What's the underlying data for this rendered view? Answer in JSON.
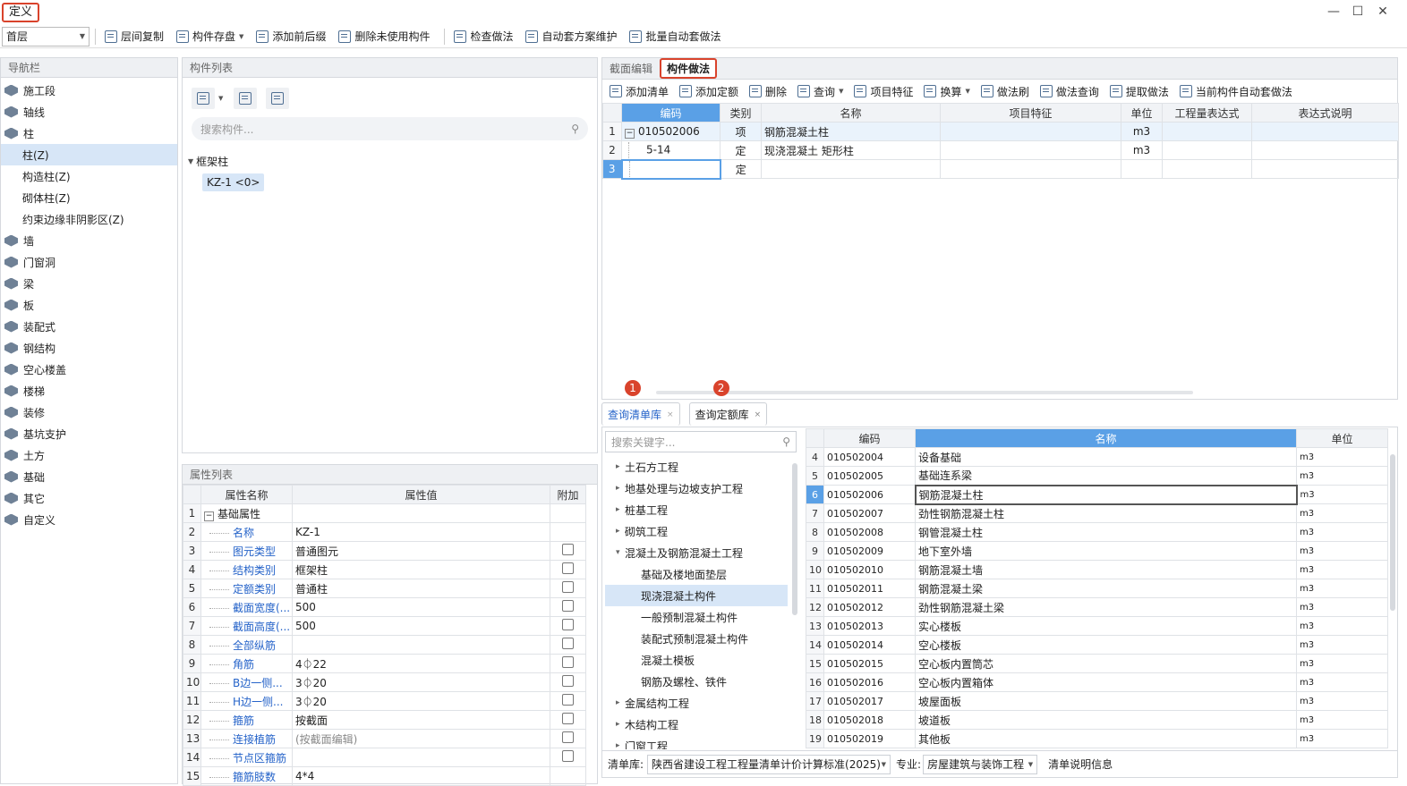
{
  "title": "定义",
  "toolbar": {
    "floor_select": "首层",
    "buttons": [
      "层间复制",
      "构件存盘",
      "添加前后缀",
      "删除未使用构件",
      "检查做法",
      "自动套方案维护",
      "批量自动套做法"
    ]
  },
  "nav": {
    "header": "导航栏",
    "items": [
      {
        "label": "施工段",
        "sub": false
      },
      {
        "label": "轴线",
        "sub": false
      },
      {
        "label": "柱",
        "sub": false
      },
      {
        "label": "柱(Z)",
        "sub": true,
        "active": true
      },
      {
        "label": "构造柱(Z)",
        "sub": true
      },
      {
        "label": "砌体柱(Z)",
        "sub": true
      },
      {
        "label": "约束边缘非阴影区(Z)",
        "sub": true
      },
      {
        "label": "墙",
        "sub": false
      },
      {
        "label": "门窗洞",
        "sub": false
      },
      {
        "label": "梁",
        "sub": false
      },
      {
        "label": "板",
        "sub": false
      },
      {
        "label": "装配式",
        "sub": false
      },
      {
        "label": "钢结构",
        "sub": false
      },
      {
        "label": "空心楼盖",
        "sub": false
      },
      {
        "label": "楼梯",
        "sub": false
      },
      {
        "label": "装修",
        "sub": false
      },
      {
        "label": "基坑支护",
        "sub": false
      },
      {
        "label": "土方",
        "sub": false
      },
      {
        "label": "基础",
        "sub": false
      },
      {
        "label": "其它",
        "sub": false
      },
      {
        "label": "自定义",
        "sub": false
      }
    ]
  },
  "component_list": {
    "header": "构件列表",
    "search_placeholder": "搜索构件...",
    "group": "框架柱",
    "item": "KZ-1 <0>"
  },
  "properties": {
    "header": "属性列表",
    "columns": [
      "属性名称",
      "属性值",
      "附加"
    ],
    "rows": [
      {
        "n": "1",
        "name": "基础属性",
        "value": "",
        "group": true
      },
      {
        "n": "2",
        "name": "名称",
        "value": "KZ-1",
        "chk": false
      },
      {
        "n": "3",
        "name": "图元类型",
        "value": "普通图元",
        "chk": true
      },
      {
        "n": "4",
        "name": "结构类别",
        "value": "框架柱",
        "chk": true
      },
      {
        "n": "5",
        "name": "定额类别",
        "value": "普通柱",
        "chk": true
      },
      {
        "n": "6",
        "name": "截面宽度(...",
        "value": "500",
        "chk": true
      },
      {
        "n": "7",
        "name": "截面高度(...",
        "value": "500",
        "chk": true
      },
      {
        "n": "8",
        "name": "全部纵筋",
        "value": "",
        "chk": true
      },
      {
        "n": "9",
        "name": "角筋",
        "value": "4⏀22",
        "chk": true
      },
      {
        "n": "10",
        "name": "B边一侧...",
        "value": "3⏀20",
        "chk": true
      },
      {
        "n": "11",
        "name": "H边一侧...",
        "value": "3⏀20",
        "chk": true
      },
      {
        "n": "12",
        "name": "箍筋",
        "value": "按截面",
        "chk": true
      },
      {
        "n": "13",
        "name": "连接植筋",
        "value": "(按截面编辑)",
        "chk": true
      },
      {
        "n": "14",
        "name": "节点区箍筋",
        "value": "",
        "chk": true
      },
      {
        "n": "15",
        "name": "箍筋肢数",
        "value": "4*4",
        "chk": false
      }
    ]
  },
  "method": {
    "tabs": [
      "截面编辑",
      "构件做法"
    ],
    "toolbar": [
      "添加清单",
      "添加定额",
      "删除",
      "查询",
      "项目特征",
      "换算",
      "做法刷",
      "做法查询",
      "提取做法",
      "当前构件自动套做法"
    ],
    "columns": [
      "编码",
      "类别",
      "名称",
      "项目特征",
      "单位",
      "工程量表达式",
      "表达式说明"
    ],
    "rows": [
      {
        "n": "1",
        "code": "010502006",
        "type": "项",
        "name": "钢筋混凝土柱",
        "feature": "",
        "unit": "m3"
      },
      {
        "n": "2",
        "code": "5-14",
        "type": "定",
        "name": "现浇混凝土 矩形柱",
        "feature": "",
        "unit": "m3"
      },
      {
        "n": "3",
        "code": "",
        "type": "定",
        "name": "",
        "feature": "",
        "unit": ""
      }
    ]
  },
  "query": {
    "tabs": [
      "查询清单库",
      "查询定额库"
    ],
    "badges": [
      "1",
      "2"
    ],
    "search_placeholder": "搜索关键字...",
    "tree": [
      {
        "label": "土石方工程",
        "level": 0,
        "arrow": "▸"
      },
      {
        "label": "地基处理与边坡支护工程",
        "level": 0,
        "arrow": "▸"
      },
      {
        "label": "桩基工程",
        "level": 0,
        "arrow": "▸"
      },
      {
        "label": "砌筑工程",
        "level": 0,
        "arrow": "▸"
      },
      {
        "label": "混凝土及钢筋混凝土工程",
        "level": 0,
        "arrow": "▾"
      },
      {
        "label": "基础及楼地面垫层",
        "level": 1,
        "arrow": ""
      },
      {
        "label": "现浇混凝土构件",
        "level": 1,
        "arrow": "",
        "active": true
      },
      {
        "label": "一般预制混凝土构件",
        "level": 1,
        "arrow": ""
      },
      {
        "label": "装配式预制混凝土构件",
        "level": 1,
        "arrow": ""
      },
      {
        "label": "混凝土模板",
        "level": 1,
        "arrow": ""
      },
      {
        "label": "钢筋及螺栓、铁件",
        "level": 1,
        "arrow": ""
      },
      {
        "label": "金属结构工程",
        "level": 0,
        "arrow": "▸"
      },
      {
        "label": "木结构工程",
        "level": 0,
        "arrow": "▸"
      },
      {
        "label": "门窗工程",
        "level": 0,
        "arrow": "▸"
      }
    ],
    "columns": [
      "编码",
      "名称",
      "单位"
    ],
    "rows": [
      {
        "n": "4",
        "code": "010502004",
        "name": "设备基础",
        "unit": "m3"
      },
      {
        "n": "5",
        "code": "010502005",
        "name": "基础连系梁",
        "unit": "m3"
      },
      {
        "n": "6",
        "code": "010502006",
        "name": "钢筋混凝土柱",
        "unit": "m3",
        "active": true
      },
      {
        "n": "7",
        "code": "010502007",
        "name": "劲性钢筋混凝土柱",
        "unit": "m3"
      },
      {
        "n": "8",
        "code": "010502008",
        "name": "钢管混凝土柱",
        "unit": "m3"
      },
      {
        "n": "9",
        "code": "010502009",
        "name": "地下室外墙",
        "unit": "m3"
      },
      {
        "n": "10",
        "code": "010502010",
        "name": "钢筋混凝土墙",
        "unit": "m3"
      },
      {
        "n": "11",
        "code": "010502011",
        "name": "钢筋混凝土梁",
        "unit": "m3"
      },
      {
        "n": "12",
        "code": "010502012",
        "name": "劲性钢筋混凝土梁",
        "unit": "m3"
      },
      {
        "n": "13",
        "code": "010502013",
        "name": "实心楼板",
        "unit": "m3"
      },
      {
        "n": "14",
        "code": "010502014",
        "name": "空心楼板",
        "unit": "m3"
      },
      {
        "n": "15",
        "code": "010502015",
        "name": "空心板内置筒芯",
        "unit": "m3"
      },
      {
        "n": "16",
        "code": "010502016",
        "name": "空心板内置箱体",
        "unit": "m3"
      },
      {
        "n": "17",
        "code": "010502017",
        "name": "坡屋面板",
        "unit": "m3"
      },
      {
        "n": "18",
        "code": "010502018",
        "name": "坡道板",
        "unit": "m3"
      },
      {
        "n": "19",
        "code": "010502019",
        "name": "其他板",
        "unit": "m3"
      }
    ],
    "footer": {
      "lib_label": "清单库:",
      "lib_value": "陕西省建设工程工程量清单计价计算标准(2025)",
      "major_label": "专业:",
      "major_value": "房屋建筑与装饰工程",
      "info": "清单说明信息"
    }
  },
  "colors": {
    "accent": "#d9432c",
    "link": "#2563c9",
    "selection": "#d7e6f7",
    "header_blue": "#5aa0e6"
  }
}
